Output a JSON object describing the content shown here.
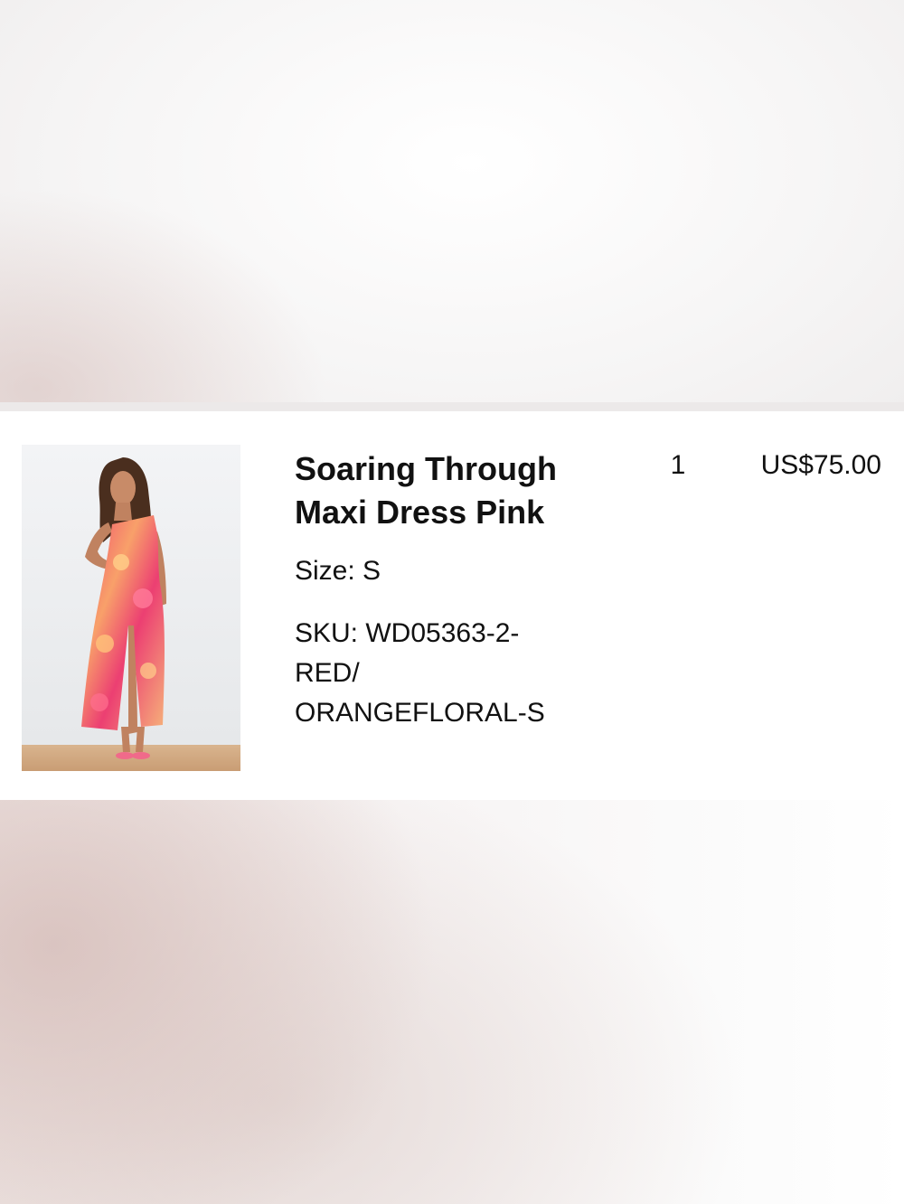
{
  "order_item": {
    "name": "Soaring Through Maxi Dress Pink",
    "size": "Size: S",
    "sku_lines": [
      "SKU: WD05363-2-",
      "RED/",
      "ORANGEFLORAL-S"
    ],
    "quantity": "1",
    "price": "US$75.00",
    "image": "product-photo-model-in-pink-floral-maxi-dress"
  }
}
